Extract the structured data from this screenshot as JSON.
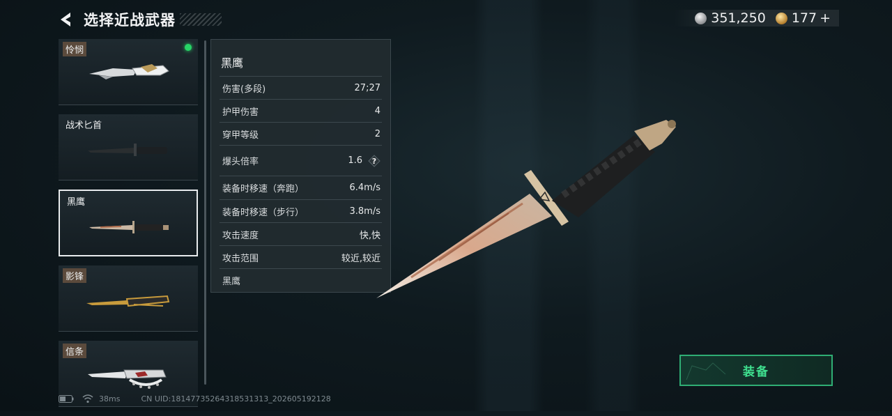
{
  "header": {
    "title": "选择近战武器"
  },
  "currency": {
    "silver": "351,250",
    "gold": "177",
    "gold_add": "+"
  },
  "weapons": [
    {
      "name": "怜悯"
    },
    {
      "name": "战术匕首"
    },
    {
      "name": "黑鹰"
    },
    {
      "name": "影锋"
    },
    {
      "name": "信条"
    }
  ],
  "panel": {
    "title": "黑鹰",
    "stats": [
      {
        "label": "伤害(多段)",
        "value": "27;27"
      },
      {
        "label": "护甲伤害",
        "value": "4"
      },
      {
        "label": "穿甲等级",
        "value": "2"
      },
      {
        "label": "爆头倍率",
        "value": "1.6"
      },
      {
        "label": "装备时移速（奔跑）",
        "value": "6.4m/s"
      },
      {
        "label": "装备时移速（步行）",
        "value": "3.8m/s"
      },
      {
        "label": "攻击速度",
        "value": "快,快"
      },
      {
        "label": "攻击范围",
        "value": "较近,较近"
      }
    ],
    "footer": "黑鹰"
  },
  "equip_button": {
    "label": "装备"
  },
  "status": {
    "ping": "38ms",
    "uid": "CN UID:1814773526431853131​3_202605192128"
  },
  "colors": {
    "accent": "#3fe08f",
    "equipped": "#27d466",
    "panel": "#222b30"
  }
}
